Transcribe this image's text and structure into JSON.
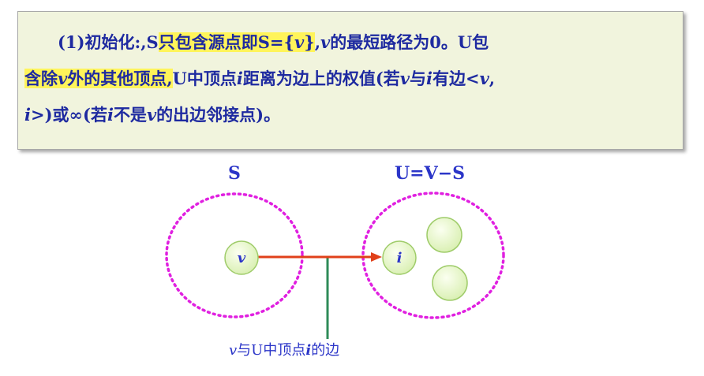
{
  "text_box": {
    "line1": {
      "indent": "",
      "p1": "(1)初始化:,S",
      "p2": "只包含源点即S={",
      "v": "v",
      "p3": "}",
      "p4": ",",
      "v2": "v",
      "p5": "的最短路径为0。U包"
    },
    "line2": {
      "p1": "含除",
      "v": "v",
      "p2": "外的其他顶点,",
      "p3": "U中顶点",
      "i": "i",
      "p4": "距离为边上的权值(若",
      "v2": "v",
      "p5": "与",
      "i2": "i",
      "p6": "有边<",
      "v3": "v",
      "p7": ","
    },
    "line3": {
      "i": "i",
      "p1": ">)或∞(若",
      "i2": "i",
      "p2": "不是",
      "v": "v",
      "p3": "的出边邻接点)。"
    }
  },
  "diagram": {
    "set_s_label": "S",
    "set_u_label": "U=V−S",
    "node_v": "v",
    "node_i": "i",
    "edge_caption_v": "v",
    "edge_caption_p1": "与U中顶点",
    "edge_caption_i": "i",
    "edge_caption_p2": "的边"
  },
  "colors": {
    "text": "#1e2aa0",
    "highlight": "#fff45a",
    "box_bg": "#f1f4dd",
    "set_border": "#e020e0",
    "node_fill": "#e6f5c4",
    "node_stroke": "#9fcc6a",
    "arrow": "#e0401a",
    "pointer": "#2e8b57"
  }
}
